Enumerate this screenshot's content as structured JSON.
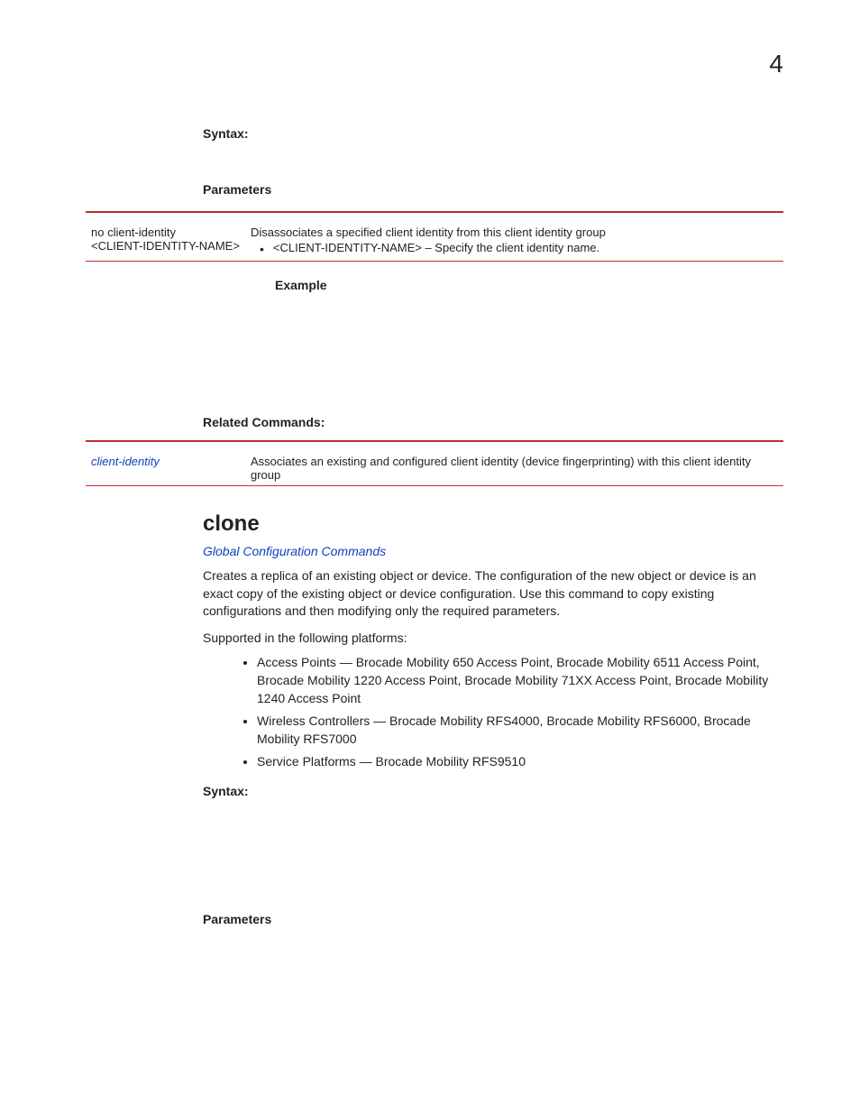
{
  "pageNumber": "4",
  "section1": {
    "syntaxLabel": "Syntax:",
    "parametersLabel": "Parameters",
    "param": {
      "left1": "no client-identity",
      "left2": "<CLIENT-IDENTITY-NAME>",
      "right1": "Disassociates a specified client identity from this client identity group",
      "right2": "<CLIENT-IDENTITY-NAME> – Specify the client identity name."
    },
    "exampleLabel": "Example",
    "relatedLabel": "Related Commands:",
    "related": {
      "link": "client-identity",
      "desc": "Associates an existing and configured client identity (device fingerprinting) with this client identity group"
    }
  },
  "section2": {
    "title": "clone",
    "link": "Global Configuration Commands",
    "para1": "Creates a replica of an existing object or device. The configuration of the new object or device is an exact copy of the existing object or device configuration. Use this command to copy existing configurations and then modifying only the required parameters.",
    "supportedLabel": "Supported in the following platforms:",
    "platforms": [
      "Access Points — Brocade Mobility 650 Access Point, Brocade Mobility 6511 Access Point, Brocade Mobility 1220 Access Point, Brocade Mobility 71XX Access Point, Brocade Mobility 1240 Access Point",
      "Wireless Controllers — Brocade Mobility RFS4000, Brocade Mobility RFS6000, Brocade Mobility RFS7000",
      "Service Platforms — Brocade Mobility RFS9510"
    ],
    "syntaxLabel": "Syntax:",
    "parametersLabel": "Parameters"
  }
}
